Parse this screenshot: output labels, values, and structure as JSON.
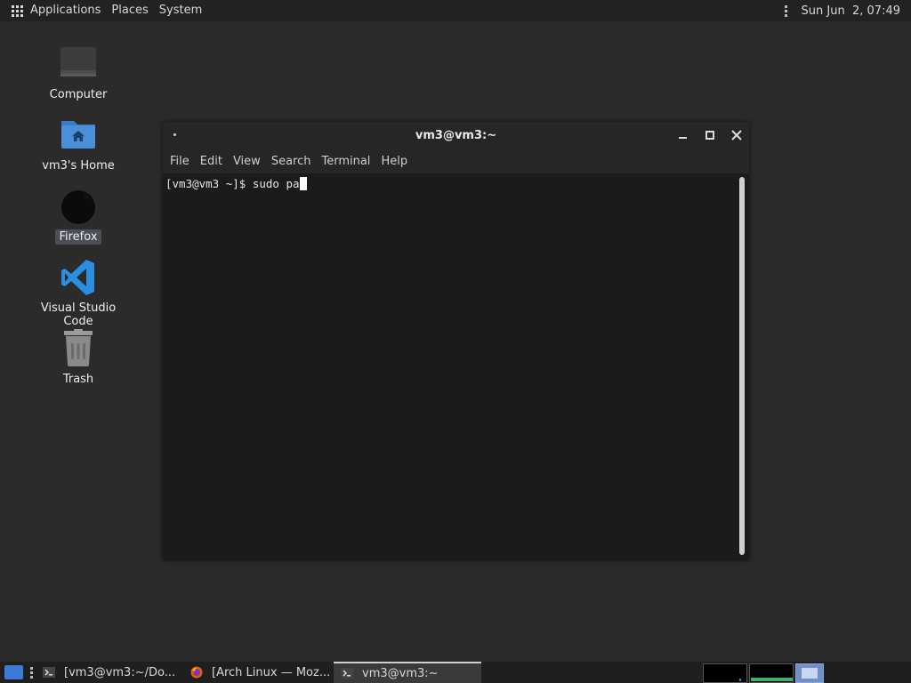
{
  "top_panel": {
    "applications": "Applications",
    "places": "Places",
    "system": "System",
    "clock": "Sun Jun  2, 07:49"
  },
  "desktop_icons": [
    {
      "label": "Computer",
      "icon": "computer-icon"
    },
    {
      "label": "vm3's Home",
      "icon": "home-folder-icon"
    },
    {
      "label": "Firefox",
      "icon": "firefox-icon"
    },
    {
      "label": "Visual Studio Code",
      "icon": "vscode-icon"
    },
    {
      "label": "Trash",
      "icon": "trash-icon"
    }
  ],
  "terminal": {
    "title": "vm3@vm3:~",
    "menu": [
      "File",
      "Edit",
      "View",
      "Search",
      "Terminal",
      "Help"
    ],
    "prompt_text": "[vm3@vm3 ~]$ sudo pa"
  },
  "taskbar": {
    "tasks": [
      {
        "label": "[vm3@vm3:~/Do...",
        "icon": "terminal-icon"
      },
      {
        "label": "[Arch Linux — Moz...",
        "icon": "firefox-icon"
      },
      {
        "label": "vm3@vm3:~",
        "icon": "terminal-icon"
      }
    ]
  },
  "colors": {
    "desktop_bg": "#2b2b2b",
    "panel_bg": "#222222",
    "terminal_bg": "#1b1b1b",
    "accent_blue": "#3c7bd6",
    "vscode_blue": "#2a8fe0",
    "folder_blue": "#4a90d9"
  }
}
